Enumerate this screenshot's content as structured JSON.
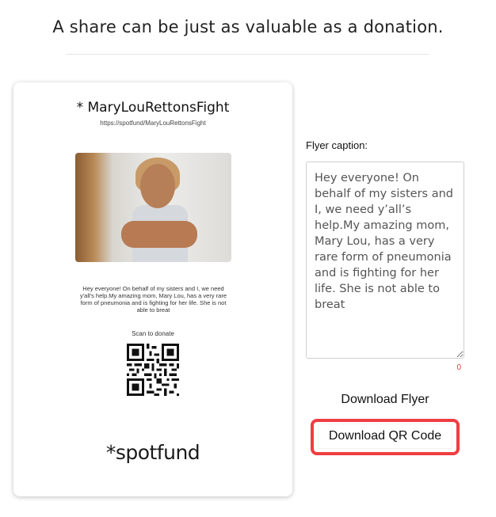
{
  "headline": "A share can be just as valuable as a donation.",
  "flyer": {
    "title": "* MaryLouRettonsFight",
    "url": "https://spotfund/MaryLouRettonsFight",
    "caption": "Hey everyone! On behalf of my sisters and I, we need y'all's help.My amazing mom, Mary Lou, has a very rare form of pneumonia and is fighting for her life. She is not able to breat",
    "scan_label": "Scan to donate",
    "logo": "*spotfund"
  },
  "caption_editor": {
    "label": "Flyer caption:",
    "value": "Hey everyone! On behalf of my sisters and I, we need y’all’s help.My amazing mom, Mary Lou, has a very rare form of pneumonia and is fighting for her life. She is not able to breat",
    "char_count": "0"
  },
  "buttons": {
    "download_flyer": "Download Flyer",
    "download_qr": "Download QR Code"
  },
  "colors": {
    "highlight": "#ef3e42",
    "char_count": "#e53935"
  }
}
